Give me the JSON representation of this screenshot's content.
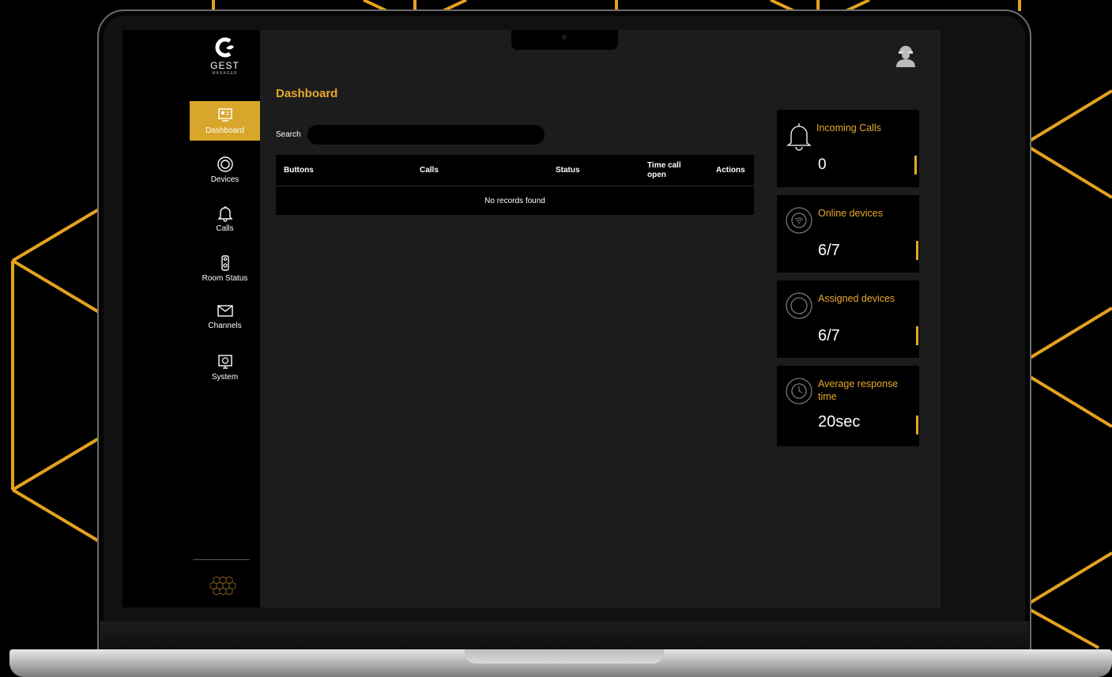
{
  "app": {
    "logo_text": "GEST",
    "logo_subtext": "MANAGER"
  },
  "colors": {
    "accent": "#e6a82e",
    "active_nav_bg": "#d9a62c",
    "main_bg": "#1c1c1c",
    "panel_bg": "#000000",
    "pattern_line": "#e6a21e"
  },
  "sidebar": {
    "items": [
      {
        "label": "Dashboard",
        "icon": "dashboard-icon",
        "active": true
      },
      {
        "label": "Devices",
        "icon": "devices-icon",
        "active": false
      },
      {
        "label": "Calls",
        "icon": "bell-icon",
        "active": false
      },
      {
        "label": "Room Status",
        "icon": "door-hanger-icon",
        "active": false
      },
      {
        "label": "Channels",
        "icon": "envelope-icon",
        "active": false
      },
      {
        "label": "System",
        "icon": "system-monitor-icon",
        "active": false
      }
    ]
  },
  "header": {
    "title": "Dashboard"
  },
  "search": {
    "label": "Search",
    "value": "",
    "placeholder": ""
  },
  "table": {
    "columns": [
      "Buttons",
      "Calls",
      "Status",
      "Time call open",
      "Actions"
    ],
    "empty_message": "No records found"
  },
  "stats": [
    {
      "label": "Incoming Calls",
      "value": "0",
      "icon": "bell-icon"
    },
    {
      "label": "Online devices",
      "value": "6/7",
      "icon": "wifi-device-icon"
    },
    {
      "label": "Assigned devices",
      "value": "6/7",
      "icon": "ring-device-icon"
    },
    {
      "label": "Average response time",
      "value": "20sec",
      "icon": "clock-icon"
    }
  ]
}
